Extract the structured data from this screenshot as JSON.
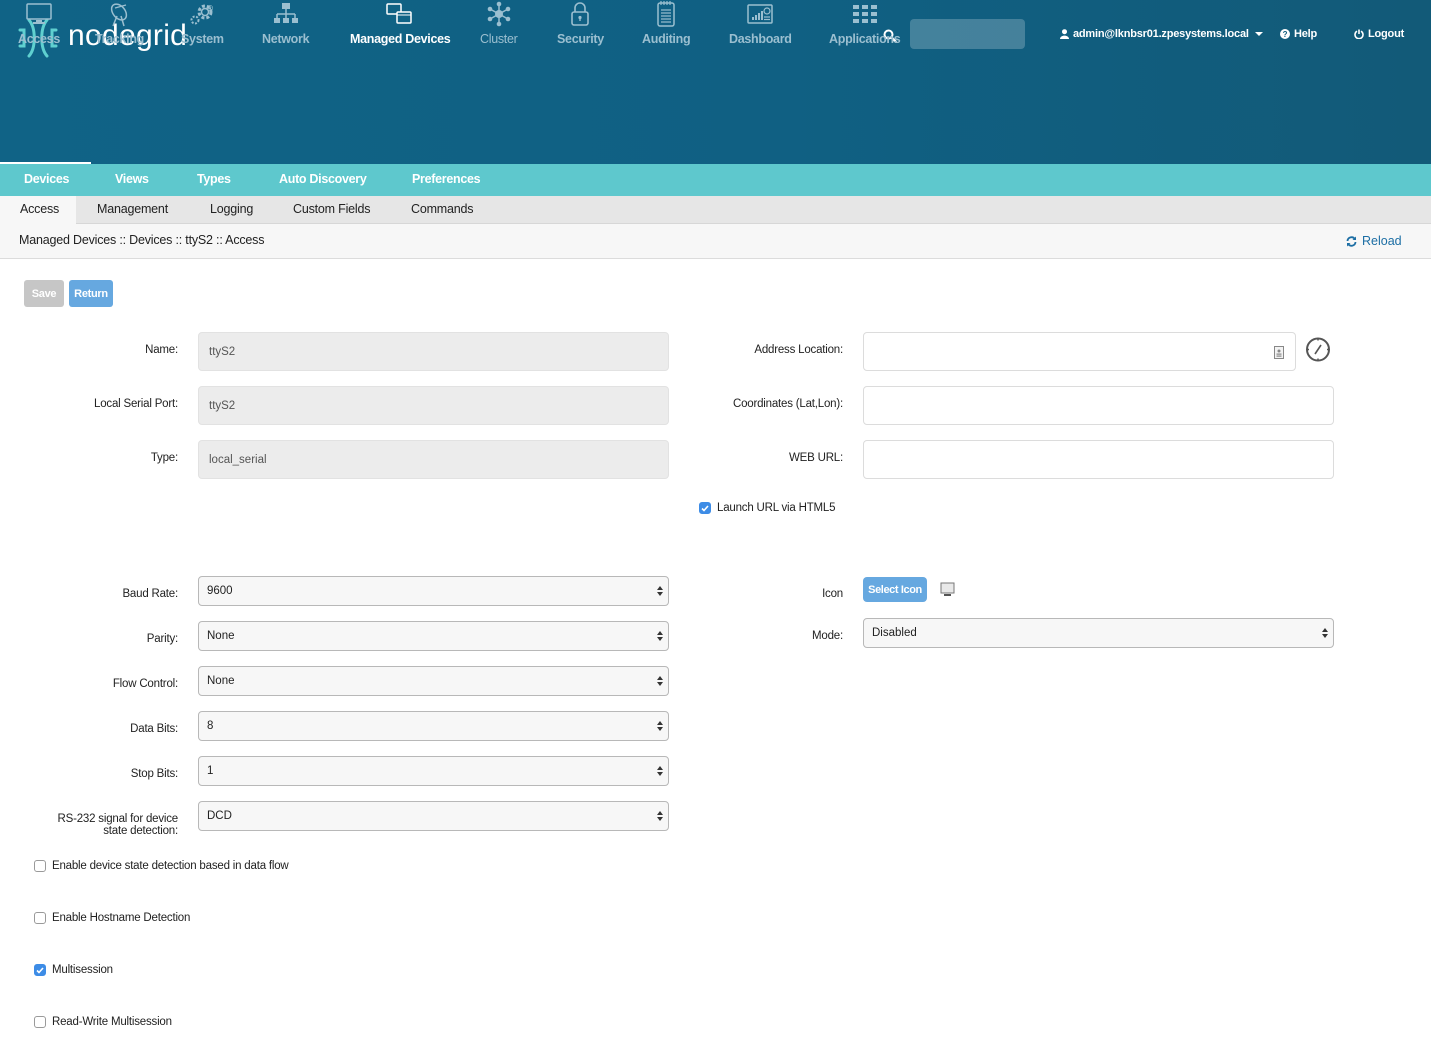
{
  "header": {
    "brand": "nodegrid",
    "brand_reg": "®",
    "search_placeholder": "",
    "user": "admin@lknbsr01.zpesystems.local",
    "help": "Help",
    "logout": "Logout",
    "colors": {
      "header_bg": "#106386",
      "subnav_bg": "#5ec8cd",
      "accent_button": "#66a8e0",
      "link": "#1c6ea4"
    }
  },
  "main_nav": [
    {
      "label": "Access",
      "icon": "monitor-icon",
      "active": false
    },
    {
      "label": "Tracking",
      "icon": "satellite-dish-icon",
      "active": false
    },
    {
      "label": "System",
      "icon": "gears-icon",
      "active": false
    },
    {
      "label": "Network",
      "icon": "network-icon",
      "active": false
    },
    {
      "label": "Managed Devices",
      "icon": "managed-devices-icon",
      "active": true
    },
    {
      "label": "Cluster",
      "icon": "cluster-icon",
      "active": false
    },
    {
      "label": "Security",
      "icon": "lock-icon",
      "active": false
    },
    {
      "label": "Auditing",
      "icon": "notepad-icon",
      "active": false
    },
    {
      "label": "Dashboard",
      "icon": "dashboard-icon",
      "active": false
    },
    {
      "label": "Applications",
      "icon": "apps-grid-icon",
      "active": false
    }
  ],
  "sub_nav": [
    "Devices",
    "Views",
    "Types",
    "Auto Discovery",
    "Preferences"
  ],
  "tabs": [
    "Access",
    "Management",
    "Logging",
    "Custom Fields",
    "Commands"
  ],
  "breadcrumb": "Managed Devices :: Devices :: ttyS2 :: Access",
  "reload": "Reload",
  "buttons": {
    "save": "Save",
    "return": "Return",
    "select_icon": "Select Icon"
  },
  "form_left": {
    "name": {
      "label": "Name:",
      "value": "ttyS2"
    },
    "local_serial_port": {
      "label": "Local Serial Port:",
      "value": "ttyS2"
    },
    "type": {
      "label": "Type:",
      "value": "local_serial"
    },
    "baud_rate": {
      "label": "Baud Rate:",
      "value": "9600"
    },
    "parity": {
      "label": "Parity:",
      "value": "None"
    },
    "flow_control": {
      "label": "Flow Control:",
      "value": "None"
    },
    "data_bits": {
      "label": "Data Bits:",
      "value": "8"
    },
    "stop_bits": {
      "label": "Stop Bits:",
      "value": "1"
    },
    "rs232": {
      "label_line1": "RS-232 signal for device",
      "label_line2": "state detection:",
      "value": "DCD"
    }
  },
  "form_right": {
    "address_location": {
      "label": "Address Location:",
      "value": ""
    },
    "coordinates": {
      "label": "Coordinates (Lat,Lon):",
      "value": ""
    },
    "web_url": {
      "label": "WEB URL:",
      "value": ""
    },
    "launch_html5": {
      "label": "Launch URL via HTML5",
      "checked": true
    },
    "icon": {
      "label": "Icon"
    },
    "mode": {
      "label": "Mode:",
      "value": "Disabled"
    }
  },
  "checkboxes": [
    {
      "label": "Enable device state detection based in data flow",
      "checked": false
    },
    {
      "label": "Enable Hostname Detection",
      "checked": false
    },
    {
      "label": "Multisession",
      "checked": true
    },
    {
      "label": "Read-Write Multisession",
      "checked": false
    }
  ]
}
